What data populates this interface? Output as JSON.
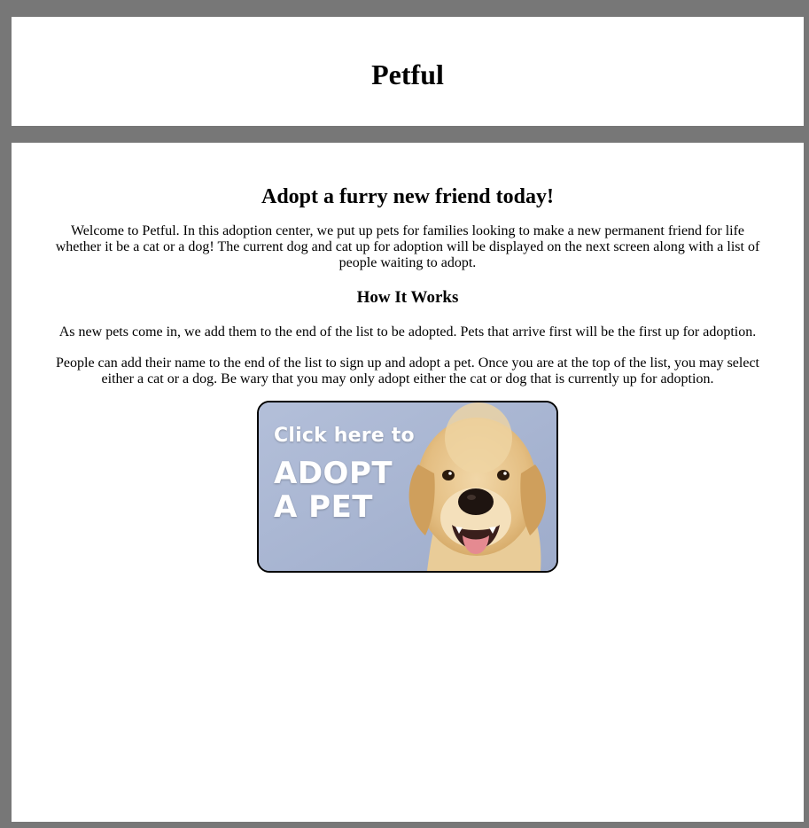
{
  "header": {
    "title": "Petful"
  },
  "main": {
    "heading": "Adopt a furry new friend today!",
    "welcome": "Welcome to Petful. In this adoption center, we put up pets for families looking to make a new permanent friend for life whether it be a cat or a dog! The current dog and cat up for adoption will be displayed on the next screen along with a list of people waiting to adopt.",
    "how_heading": "How It Works",
    "how_p1": "As new pets come in, we add them to the end of the list to be adopted. Pets that arrive first will be the first up for adoption.",
    "how_p2": "People can add their name to the end of the list to sign up and adopt a pet. Once you are at the top of the list, you may select either a cat or a dog. Be wary that you may only adopt either the cat or dog that is currently up for adoption."
  },
  "banner": {
    "line1": "Click here to",
    "line2": "ADOPT",
    "line3": "A PET",
    "icon": "golden-retriever-puppy",
    "colors": {
      "background": "#a9b7d3",
      "fur": "#e7c48c",
      "text": "#ffffff"
    }
  }
}
